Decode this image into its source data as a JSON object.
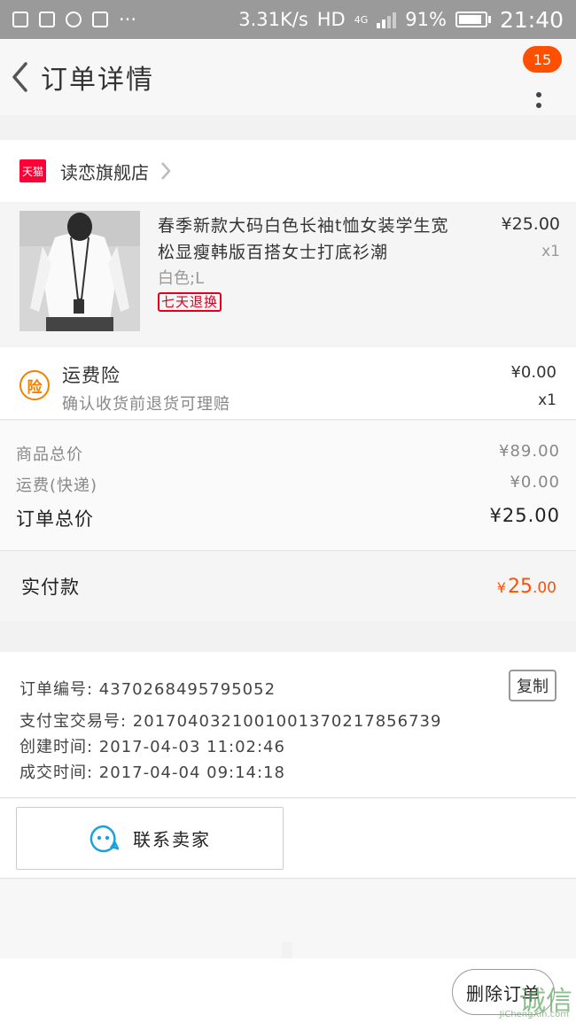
{
  "status_bar": {
    "speed": "3.31K/s",
    "network": "HD",
    "network_gen": "4G",
    "battery": "91%",
    "battery_level": 0.91,
    "time": "21:40"
  },
  "header": {
    "title": "订单详情",
    "badge": "15"
  },
  "shop": {
    "tmall_label": "天猫",
    "name": "读恋旗舰店"
  },
  "product": {
    "title": "春季新款大码白色长袖t恤女装学生宽松显瘦韩版百搭女士打底衫潮",
    "sku": "白色;L",
    "tag": "七天退换",
    "price": "¥25.00",
    "qty": "x1"
  },
  "insurance": {
    "icon_label": "险",
    "title": "运费险",
    "subtitle": "确认收货前退货可理赔",
    "price": "¥0.00",
    "qty": "x1"
  },
  "totals": {
    "goods_label": "商品总价",
    "goods_value": "¥89.00",
    "shipping_label": "运费(快递)",
    "shipping_value": "¥0.00",
    "order_label": "订单总价",
    "order_value": "¥25.00"
  },
  "paid": {
    "label": "实付款",
    "currency": "¥",
    "amount_int": "25",
    "amount_dec": ".00"
  },
  "order_info": {
    "order_no": "订单编号: 4370268495795052",
    "copy_label": "复制",
    "alipay_no": "支付宝交易号: 2017040321001001370217856739",
    "created": "创建时间: 2017-04-03 11:02:46",
    "completed": "成交时间: 2017-04-04 09:14:18"
  },
  "actions": {
    "contact_label": "联系卖家",
    "delete_label": "删除订单"
  },
  "watermark": {
    "main": "诚信",
    "sub": "JiChengXin.com"
  },
  "colors": {
    "accent": "#ff5000",
    "tmall": "#ff0036",
    "insurance": "#f08200"
  }
}
